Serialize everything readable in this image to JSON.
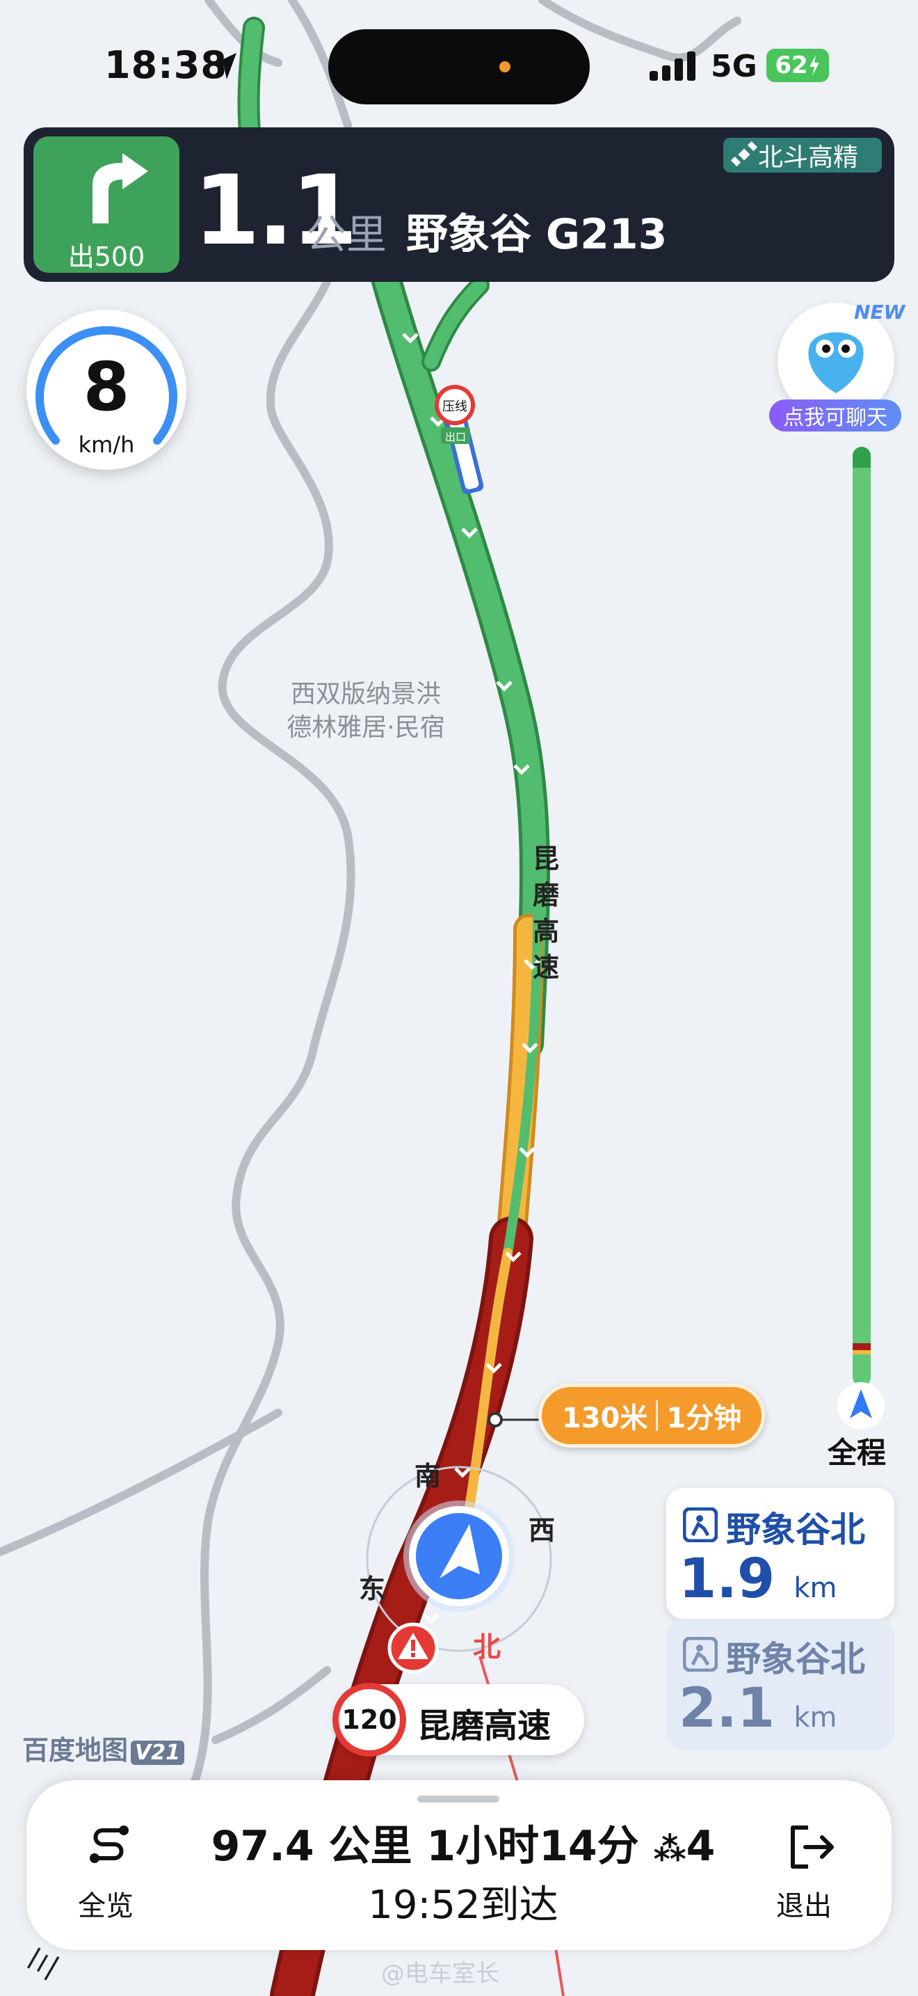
{
  "status_bar": {
    "time": "18:38",
    "network": "5G",
    "battery": "62"
  },
  "banner": {
    "exit_label": "出500",
    "distance": "1.1",
    "unit": "公里",
    "road": "野象谷 G213",
    "positioning_badge": "北斗高精"
  },
  "speed": {
    "value": "8",
    "unit": "km/h"
  },
  "assistant": {
    "new_tag": "NEW",
    "label": "点我可聊天"
  },
  "progress": {
    "label": "全程"
  },
  "map": {
    "poi_line1": "西双版纳景洪",
    "poi_line2": "德林雅居·民宿",
    "road_label": "昆磨高速",
    "marker_text_1": "压线",
    "marker_text_2": "出口",
    "highway_diag": "三"
  },
  "traffic": {
    "distance": "130米",
    "duration": "1分钟"
  },
  "compass": {
    "n": "北",
    "s": "南",
    "e": "东",
    "w": "西"
  },
  "current_road": {
    "speed_limit": "120",
    "name": "昆磨高速"
  },
  "exits": [
    {
      "name": "野象谷北",
      "distance": "1.9",
      "unit": "km"
    },
    {
      "name": "野象谷北",
      "distance": "2.1",
      "unit": "km"
    }
  ],
  "brand": {
    "name": "百度地图",
    "version": "V21"
  },
  "bottom": {
    "overview": "全览",
    "trip": "97.4 公里  1小时14分",
    "lights_icon": "traffic-light-icon",
    "lights": "4",
    "arrival": "19:52到达",
    "exit": "退出"
  },
  "watermark": "@电车室长",
  "colors": {
    "smooth": "#4fb86b",
    "slow": "#f5b640",
    "jam": "#a61d17",
    "accent": "#2f7bf5"
  }
}
